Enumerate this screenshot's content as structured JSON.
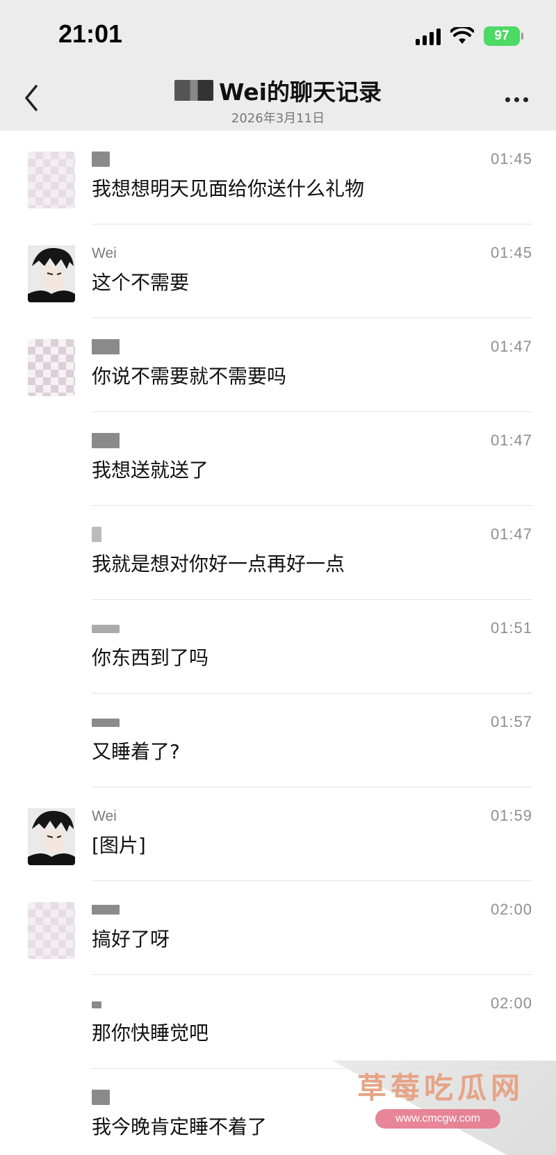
{
  "status_bar": {
    "time": "21:01",
    "battery": "97"
  },
  "header": {
    "title": "Wei的聊天记录",
    "date": "2026年3月11日"
  },
  "messages": [
    {
      "sender": "",
      "avatar": "mosaic",
      "text": "我想想明天见面给你送什么礼物",
      "time": "01:45"
    },
    {
      "sender": "Wei",
      "avatar": "wei",
      "text": "这个不需要",
      "time": "01:45"
    },
    {
      "sender": "",
      "avatar": "mosaic",
      "text": "你说不需要就不需要吗",
      "time": "01:47"
    },
    {
      "sender": "",
      "avatar": "none",
      "text": "我想送就送了",
      "time": "01:47"
    },
    {
      "sender": "",
      "avatar": "none",
      "text": "我就是想对你好一点再好一点",
      "time": "01:47"
    },
    {
      "sender": "",
      "avatar": "none",
      "text": "你东西到了吗",
      "time": "01:51"
    },
    {
      "sender": "",
      "avatar": "none",
      "text": "又睡着了?",
      "time": "01:57"
    },
    {
      "sender": "Wei",
      "avatar": "wei",
      "text": "[图片]",
      "time": "01:59"
    },
    {
      "sender": "",
      "avatar": "mosaic",
      "text": "搞好了呀",
      "time": "02:00"
    },
    {
      "sender": "",
      "avatar": "none",
      "text": "那你快睡觉吧",
      "time": "02:00"
    },
    {
      "sender": "",
      "avatar": "none",
      "text": "我今晚肯定睡不着了",
      "time": ""
    }
  ],
  "watermark": {
    "title": "草莓吃瓜网",
    "url": "www.cmcgw.com"
  },
  "icons": {
    "back": "chevron-left-icon",
    "more": "more-icon",
    "signal": "signal-icon",
    "wifi": "wifi-icon",
    "battery": "battery-icon"
  },
  "colors": {
    "header_bg": "#ececec",
    "battery_green": "#4cd964",
    "text_primary": "#111111",
    "text_secondary": "#8e8e8e"
  }
}
